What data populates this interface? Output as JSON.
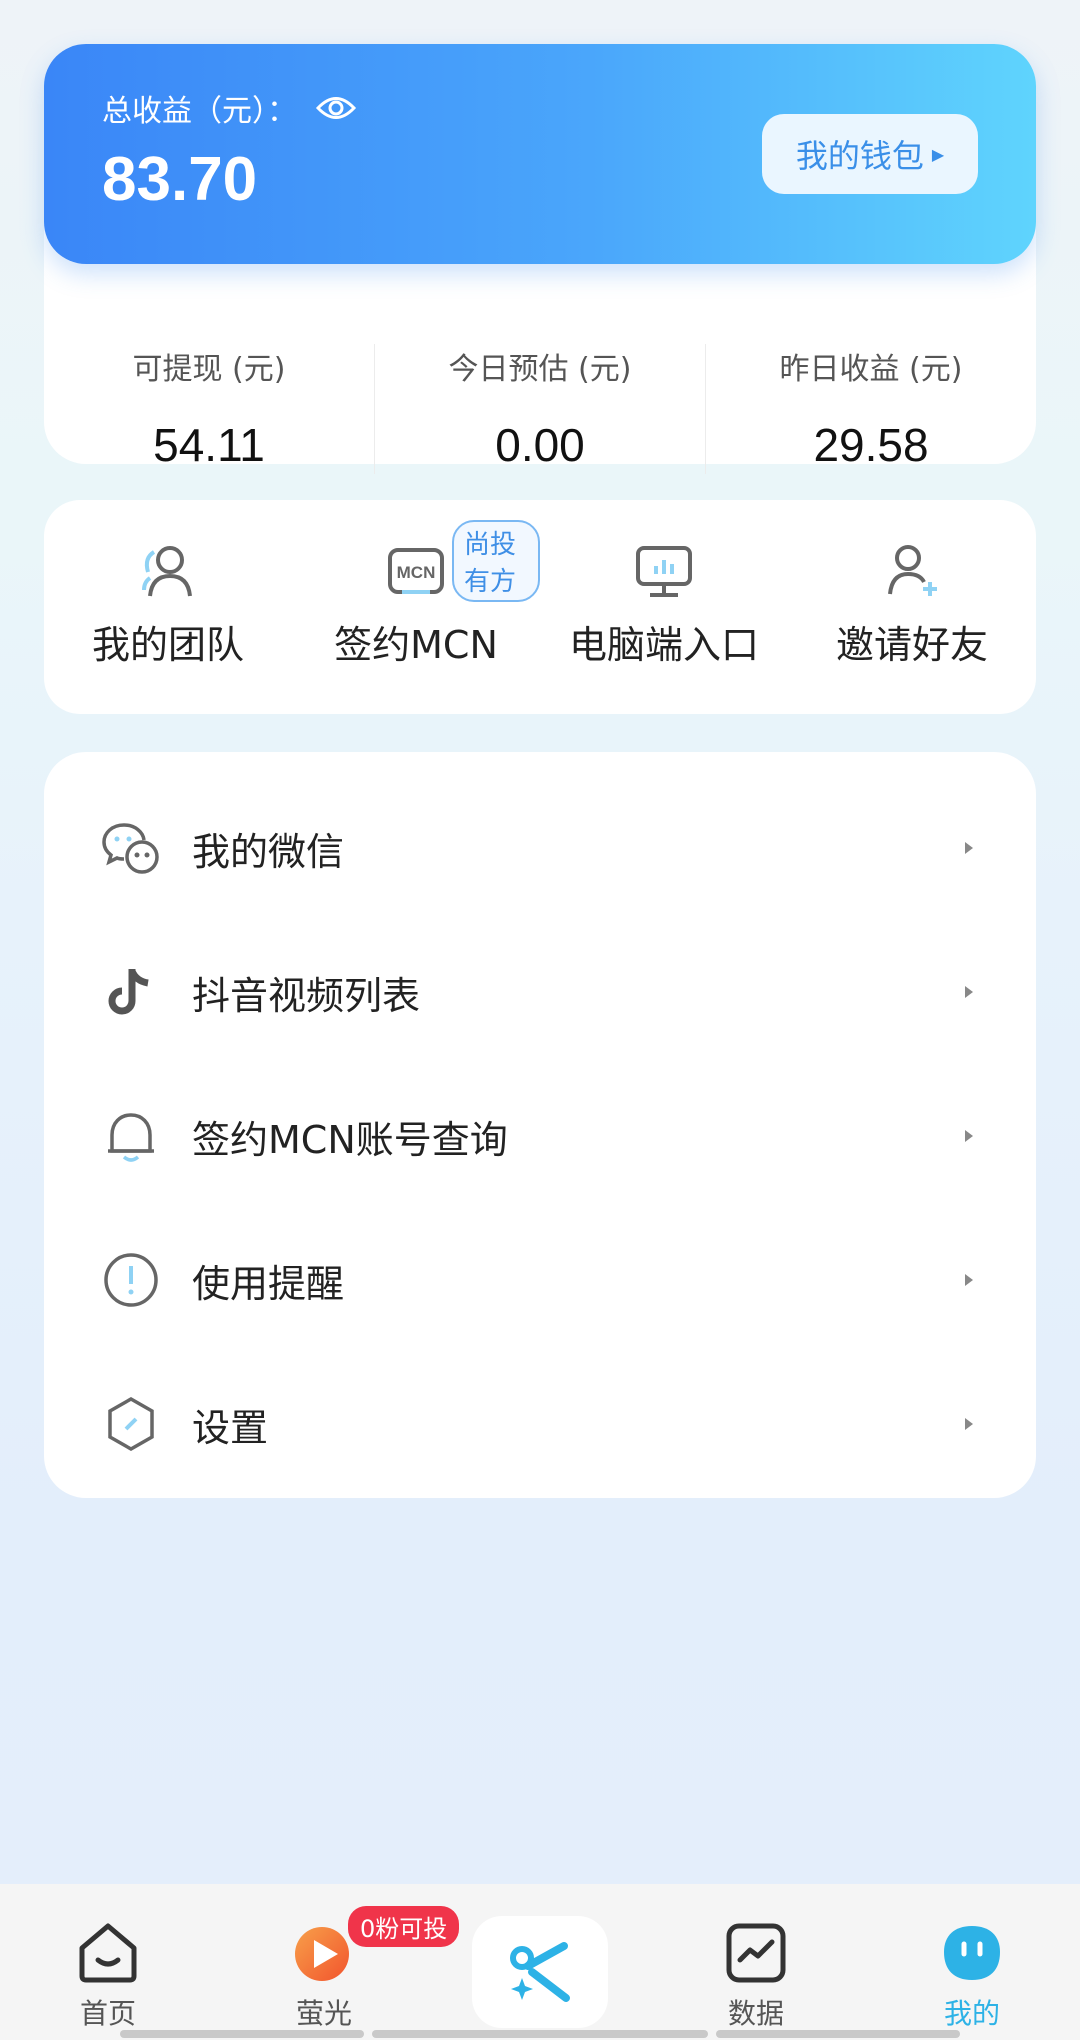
{
  "earnings": {
    "total_label": "总收益（元）：",
    "total_value": "83.70",
    "wallet_button": "我的钱包",
    "stats": [
      {
        "label": "可提现 (元)",
        "value": "54.11"
      },
      {
        "label": "今日预估 (元)",
        "value": "0.00"
      },
      {
        "label": "昨日收益 (元)",
        "value": "29.58"
      }
    ]
  },
  "quick_actions": {
    "items": [
      {
        "label": "我的团队",
        "icon": "team-icon"
      },
      {
        "label": "签约MCN",
        "icon": "mcn-icon",
        "badge": "尚投有方"
      },
      {
        "label": "电脑端入口",
        "icon": "computer-icon"
      },
      {
        "label": "邀请好友",
        "icon": "invite-friend-icon"
      }
    ]
  },
  "menu": {
    "items": [
      {
        "label": "我的微信",
        "icon": "wechat-icon"
      },
      {
        "label": "抖音视频列表",
        "icon": "douyin-icon"
      },
      {
        "label": "签约MCN账号查询",
        "icon": "bell-icon"
      },
      {
        "label": "使用提醒",
        "icon": "alert-icon"
      },
      {
        "label": "设置",
        "icon": "settings-icon"
      }
    ]
  },
  "bottom_nav": {
    "items": [
      {
        "label": "首页",
        "icon": "home-icon",
        "active": false
      },
      {
        "label": "萤光",
        "icon": "yingguang-icon",
        "active": false,
        "badge": "0粉可投"
      },
      {
        "label": "",
        "icon": "capcut-icon",
        "active": false
      },
      {
        "label": "数据",
        "icon": "data-chart-icon",
        "active": false
      },
      {
        "label": "我的",
        "icon": "profile-icon",
        "active": true
      }
    ]
  },
  "colors": {
    "accent": "#2db2e6",
    "card_gradient_start": "#3a86f7",
    "card_gradient_end": "#5fd4fd",
    "badge_red": "#f0344a"
  }
}
